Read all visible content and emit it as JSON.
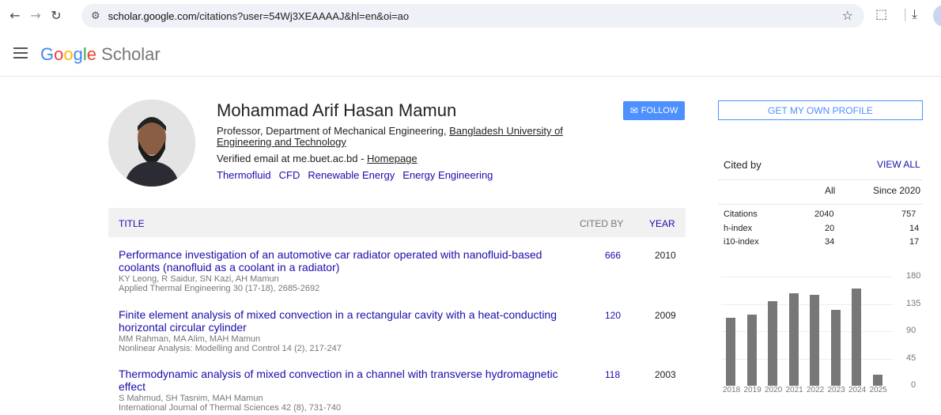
{
  "browser": {
    "url_host": "scholar.google.com",
    "url_path": "/citations?user=54Wj3XEAAAAJ&hl=en&oi=ao"
  },
  "header": {
    "logo_google": "Google",
    "logo_scholar": "Scholar"
  },
  "profile": {
    "name": "Mohammad Arif Hasan Mamun",
    "affiliation_prefix": "Professor, Department of Mechanical Engineering, ",
    "affiliation_link": "Bangladesh University of Engineering and Technology",
    "email": "Verified email at me.buet.ac.bd - ",
    "homepage": "Homepage",
    "interests": [
      "Thermofluid",
      "CFD",
      "Renewable Energy",
      "Energy Engineering"
    ],
    "follow_label": "FOLLOW"
  },
  "table": {
    "col_title": "TITLE",
    "col_cited": "CITED BY",
    "col_year": "YEAR",
    "rows": [
      {
        "title": "Performance investigation of an automotive car radiator operated with nanofluid-based coolants (nanofluid as a coolant in a radiator)",
        "authors": "KY Leong, R Saidur, SN Kazi, AH Mamun",
        "venue": "Applied Thermal Engineering 30 (17-18), 2685-2692",
        "cites": "666",
        "year": "2010"
      },
      {
        "title": "Finite element analysis of mixed convection in a rectangular cavity with a heat-conducting horizontal circular cylinder",
        "authors": "MM Rahman, MA Alim, MAH Mamun",
        "venue": "Nonlinear Analysis: Modelling and Control 14 (2), 217-247",
        "cites": "120",
        "year": "2009"
      },
      {
        "title": "Thermodynamic analysis of mixed convection in a channel with transverse hydromagnetic effect",
        "authors": "S Mahmud, SH Tasnim, MAH Mamun",
        "venue": "International Journal of Thermal Sciences 42 (8), 731-740",
        "cites": "118",
        "year": "2003"
      }
    ]
  },
  "sidebar": {
    "get_profile": "GET MY OWN PROFILE",
    "cited_by": "Cited by",
    "view_all": "VIEW ALL",
    "col_all": "All",
    "col_since": "Since 2020",
    "stats": [
      {
        "label": "Citations",
        "all": "2040",
        "since": "757"
      },
      {
        "label": "h-index",
        "all": "20",
        "since": "14"
      },
      {
        "label": "i10-index",
        "all": "34",
        "since": "17"
      }
    ]
  },
  "chart_data": {
    "type": "bar",
    "categories": [
      "2018",
      "2019",
      "2020",
      "2021",
      "2022",
      "2023",
      "2024",
      "2025"
    ],
    "values": [
      112,
      118,
      140,
      152,
      150,
      125,
      160,
      18
    ],
    "yticks": [
      "180",
      "135",
      "90",
      "45",
      "0"
    ],
    "ylim": [
      0,
      180
    ]
  }
}
